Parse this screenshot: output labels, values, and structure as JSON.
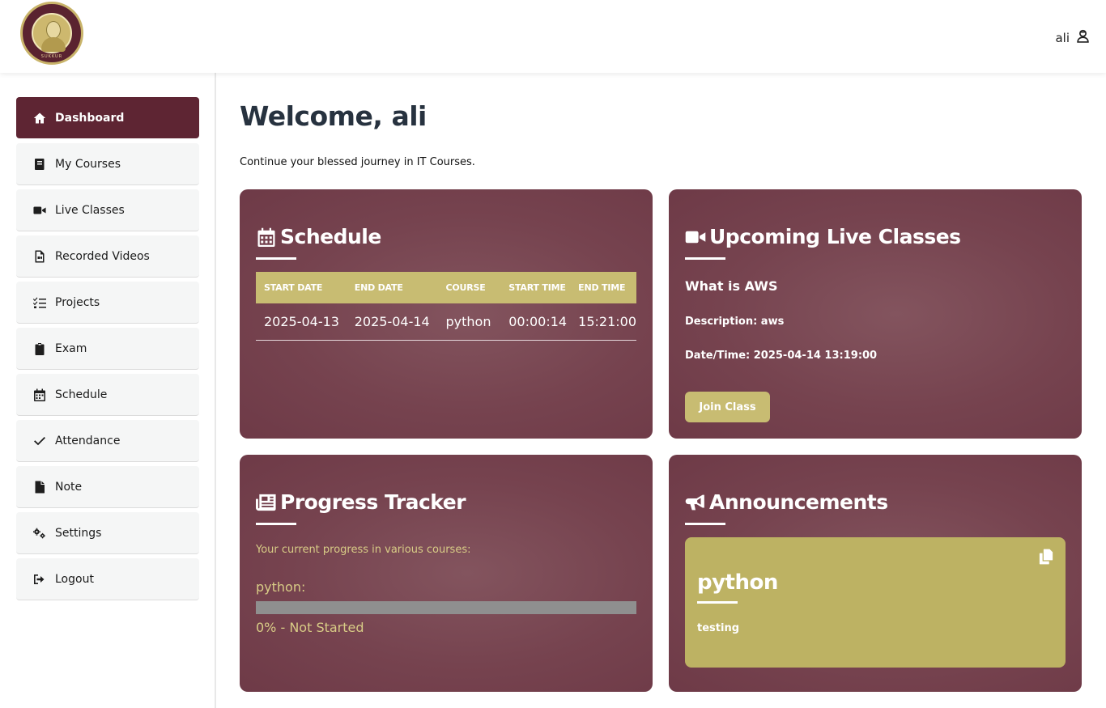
{
  "header": {
    "logo_text": "SUKKUR",
    "username": "ali"
  },
  "sidebar": {
    "items": [
      {
        "label": "Dashboard",
        "icon": "home-icon"
      },
      {
        "label": "My Courses",
        "icon": "book-icon"
      },
      {
        "label": "Live Classes",
        "icon": "video-icon"
      },
      {
        "label": "Recorded Videos",
        "icon": "video-file-icon"
      },
      {
        "label": "Projects",
        "icon": "list-check-icon"
      },
      {
        "label": "Exam",
        "icon": "clipboard-icon"
      },
      {
        "label": "Schedule",
        "icon": "calendar-icon"
      },
      {
        "label": "Attendance",
        "icon": "check-icon"
      },
      {
        "label": "Note",
        "icon": "file-icon"
      },
      {
        "label": "Settings",
        "icon": "gears-icon"
      },
      {
        "label": "Logout",
        "icon": "logout-icon"
      }
    ],
    "active": "Dashboard"
  },
  "main": {
    "welcome": "Welcome, ali",
    "subtitle": "Continue your blessed journey in IT Courses."
  },
  "schedule": {
    "title": "Schedule",
    "headers": [
      "START DATE",
      "END DATE",
      "COURSE",
      "START TIME",
      "END TIME"
    ],
    "rows": [
      [
        "2025-04-13",
        "2025-04-14",
        "python",
        "00:00:14",
        "15:21:00"
      ]
    ]
  },
  "live_classes": {
    "title": "Upcoming Live Classes",
    "class_name": "What is AWS",
    "description": "Description: aws",
    "datetime": "Date/Time: 2025-04-14 13:19:00",
    "join_label": "Join Class"
  },
  "progress": {
    "title": "Progress Tracker",
    "intro": "Your current progress in various courses:",
    "course": "python:",
    "percent": 0,
    "status": "0% - Not Started"
  },
  "announcements": {
    "title": "Announcements",
    "item_title": "python",
    "item_text": "testing"
  },
  "colors": {
    "brand": "#5e2533",
    "card": "#76434f",
    "accent": "#c8bc72",
    "announcement": "#bdb263"
  }
}
